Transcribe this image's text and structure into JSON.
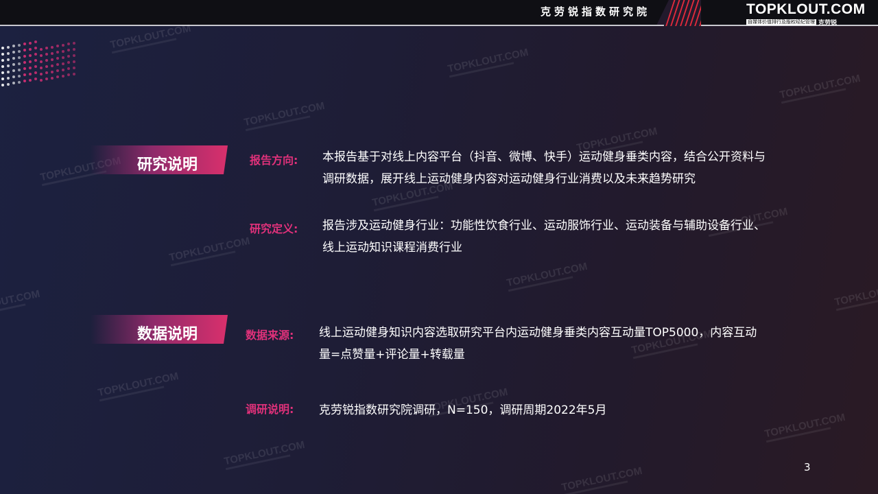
{
  "header": {
    "title": "克劳锐指数研究院",
    "logo": "TOPKLOUT.COM",
    "logo_tagline": "自媒体价值排行及版权经纪管理",
    "logo_brand": "克劳锐"
  },
  "watermark": "TOPKLOUT.COM",
  "sections": {
    "research": {
      "tag": "研究说明",
      "direction_label": "报告方向:",
      "direction_text": "本报告基于对线上内容平台（抖音、微博、快手）运动健身垂类内容，结合公开资料与调研数据，展开线上运动健身内容对运动健身行业消费以及未来趋势研究",
      "definition_label": "研究定义:",
      "definition_text": "报告涉及运动健身行业：功能性饮食行业、运动服饰行业、运动装备与辅助设备行业、线上运动知识课程消费行业"
    },
    "data": {
      "tag": "数据说明",
      "source_label": "数据来源:",
      "source_text": "线上运动健身知识内容选取研究平台内运动健身垂类内容互动量TOP5000，内容互动量=点赞量+评论量+转载量",
      "survey_label": "调研说明:",
      "survey_text": "克劳锐指数研究院调研，N=150，调研周期2022年5月"
    }
  },
  "page_number": "3",
  "colors": {
    "accent": "#e0317a",
    "header_stripe": "#e02a3c"
  }
}
